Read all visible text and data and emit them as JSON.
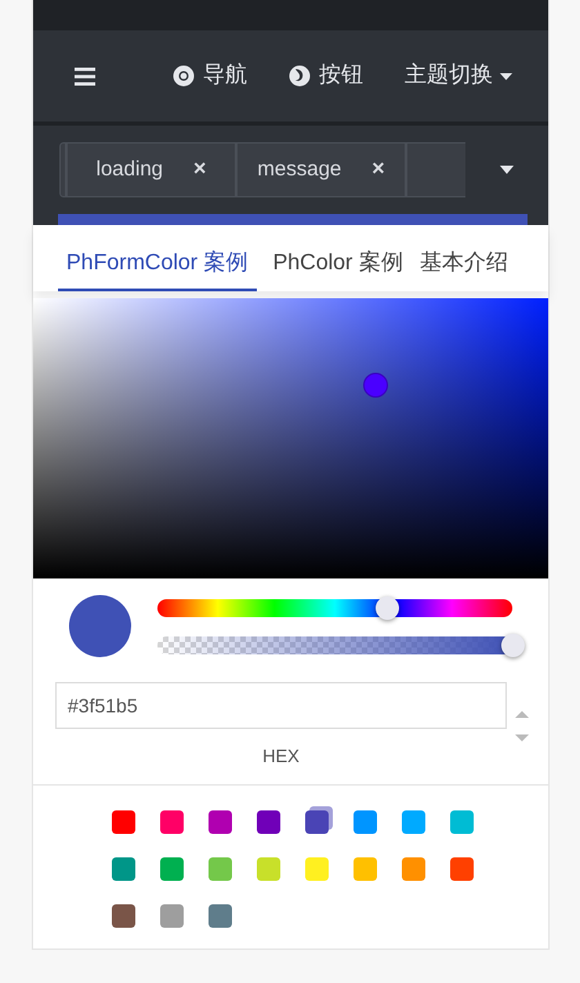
{
  "nav": {
    "items": [
      {
        "kind": "menu"
      },
      {
        "kind": "link",
        "label": "导航"
      },
      {
        "kind": "link",
        "label": "按钮"
      },
      {
        "kind": "dropdown",
        "label": "主题切换"
      }
    ]
  },
  "open_tabs": [
    {
      "kind": "full",
      "label": "loading",
      "close": "×"
    },
    {
      "kind": "full",
      "label": "message",
      "close": "×"
    },
    {
      "kind": "partial"
    }
  ],
  "page_tabs": [
    {
      "label": "PhFormColor 案例",
      "selected": true
    },
    {
      "label": "PhColor 案例",
      "selected": false
    },
    {
      "label": "基本介绍",
      "selected": false
    }
  ],
  "color_picker": {
    "hue": {
      "level": 0.646
    },
    "alpha": {
      "level": 1
    },
    "value": "#3f51b5",
    "format": "HEX"
  },
  "swatches": [
    {
      "color": "#ff0000",
      "selected": false
    },
    {
      "color": "#ff0066",
      "selected": false
    },
    {
      "color": "#b000b0",
      "selected": false
    },
    {
      "color": "#7000b8",
      "selected": false
    },
    {
      "color": "#4a44b5",
      "selected": true
    },
    {
      "color": "#0095ff",
      "selected": false
    },
    {
      "color": "#00aaff",
      "selected": false
    },
    {
      "color": "#00bcd4",
      "selected": false
    },
    {
      "color": "#009688",
      "selected": false
    },
    {
      "color": "#00b050",
      "selected": false
    },
    {
      "color": "#74c84a",
      "selected": false
    },
    {
      "color": "#c8e02a",
      "selected": false
    },
    {
      "color": "#fff020",
      "selected": false
    },
    {
      "color": "#ffc000",
      "selected": false
    },
    {
      "color": "#ff9000",
      "selected": false
    },
    {
      "color": "#ff4000",
      "selected": false
    },
    {
      "color": "#7a5548",
      "selected": false
    },
    {
      "color": "#9e9e9e",
      "selected": false
    },
    {
      "color": "#5f7d8b",
      "selected": false
    }
  ]
}
